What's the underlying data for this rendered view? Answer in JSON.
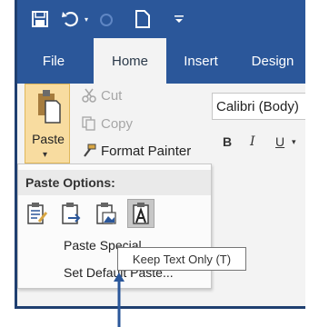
{
  "ribbon_tabs": [
    {
      "label": "File"
    },
    {
      "label": "Home"
    },
    {
      "label": "Insert"
    },
    {
      "label": "Design"
    }
  ],
  "clipboard": {
    "paste_label": "Paste",
    "cut_label": "Cut",
    "copy_label": "Copy",
    "format_painter_label": "Format Painter"
  },
  "font": {
    "name": "Calibri (Body)",
    "bold_label": "B",
    "italic_label": "I",
    "underline_label": "U"
  },
  "paste_menu": {
    "header": "Paste Options:",
    "paste_special": "Paste Special...",
    "set_default": "Set Default Paste..."
  },
  "tooltip": "Keep Text Only (T)",
  "colors": {
    "title_bar": "#2b579a",
    "paste_highlight": "#f8dca0",
    "hover_option": "#c7c7c7"
  }
}
